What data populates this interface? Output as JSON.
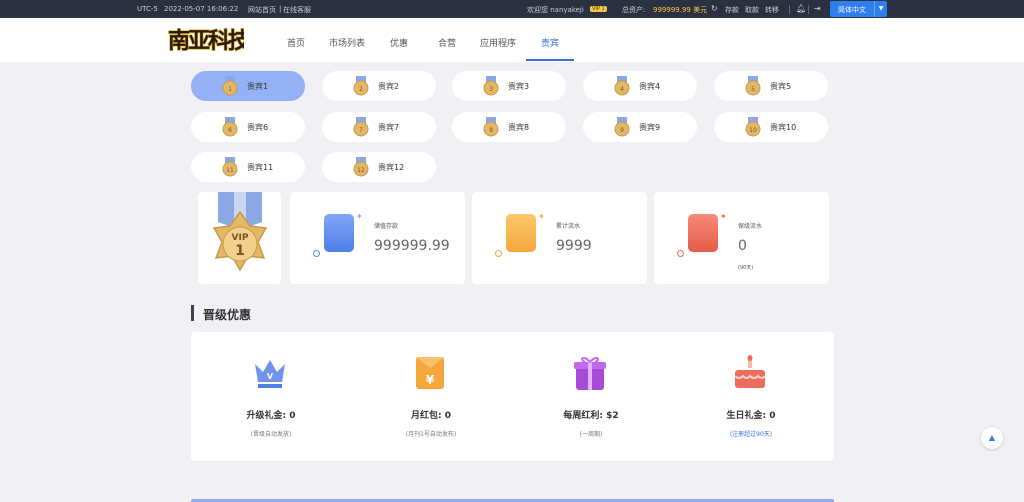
{
  "topbar": {
    "timezone": "UTC-5",
    "datetime": "2022-05-07 16:06:22",
    "links": [
      "网站首页",
      "在线客服"
    ],
    "welcome": "欢迎您 nanyakeji",
    "vip_tag": "VIP 1",
    "assets_label": "总资产:",
    "assets_value": "999999.99 美元",
    "actions": [
      "存款",
      "取款",
      "转移"
    ],
    "language": "简体中文"
  },
  "nav": {
    "logo_text": "南亚科技",
    "items": [
      "首页",
      "市场列表",
      "优惠",
      "合营",
      "应用程序",
      "贵宾"
    ],
    "active": "贵宾"
  },
  "vip_tabs": {
    "items": [
      "贵宾1",
      "贵宾2",
      "贵宾3",
      "贵宾4",
      "贵宾5",
      "贵宾6",
      "贵宾7",
      "贵宾8",
      "贵宾9",
      "贵宾10",
      "贵宾11",
      "贵宾12"
    ],
    "active_index": 0
  },
  "medal": {
    "top": "VIP",
    "level": "1"
  },
  "stats": [
    {
      "caption": "储值存款",
      "value": "999999.99",
      "sub": "",
      "color": "#5b8ef2"
    },
    {
      "caption": "累计流水",
      "value": "9999",
      "sub": "",
      "color": "#f5a73b"
    },
    {
      "caption": "保级流水",
      "value": "0",
      "sub": "(90天)",
      "color": "#ef6b5b"
    }
  ],
  "section": {
    "title": "晋级优惠",
    "benefits": [
      {
        "name": "升级礼金: 0",
        "note": "(晋级自动发放)",
        "icon": "crown-icon"
      },
      {
        "name": "月红包: 0",
        "note": "(月刊1号自动发布)",
        "icon": "red-envelope-icon"
      },
      {
        "name": "每周红利: $2",
        "note": "(一周期)",
        "icon": "gift-icon"
      },
      {
        "name": "生日礼金: 0",
        "note": "(注册超过90天)",
        "icon": "cake-icon"
      }
    ]
  }
}
